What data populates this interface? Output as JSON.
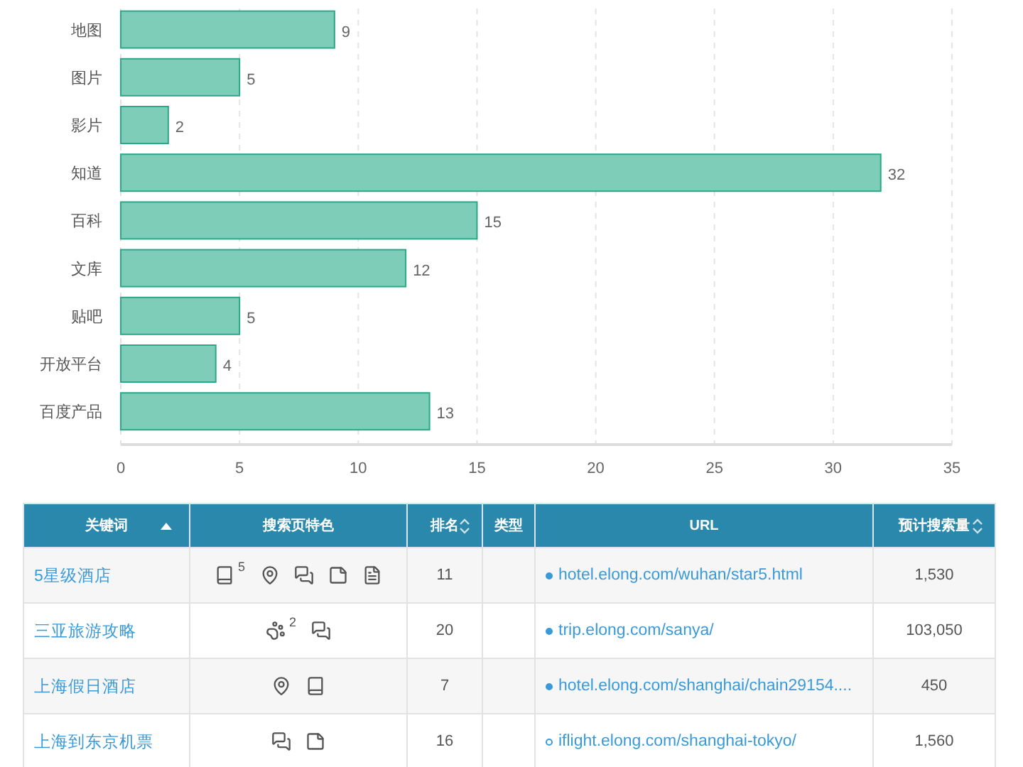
{
  "chart": {
    "chart_data": {
      "type": "bar",
      "orientation": "horizontal",
      "categories": [
        "地图",
        "图片",
        "影片",
        "知道",
        "百科",
        "文库",
        "贴吧",
        "开放平台",
        "百度产品"
      ],
      "series": [
        {
          "color": "#7dcdb8",
          "values": [
            9,
            5,
            2,
            32,
            15,
            12,
            5,
            4,
            13
          ]
        }
      ],
      "xlim": [
        0,
        35
      ],
      "grid": true,
      "xticks": [
        0,
        5,
        10,
        15,
        20,
        25,
        30,
        35
      ],
      "data_labels": true
    }
  },
  "table": {
    "columns": [
      {
        "label": "关键词",
        "sortable": true,
        "sorted_ascending": true
      },
      {
        "label": "搜索页特色",
        "sortable": false,
        "sorted_ascending": false
      },
      {
        "label": "排名",
        "sortable": true,
        "sorted_ascending": false
      },
      {
        "label": "类型",
        "sortable": false,
        "sorted_ascending": false
      },
      {
        "label": "URL",
        "sortable": false,
        "sorted_ascending": false
      },
      {
        "label": "预计搜索量",
        "sortable": true,
        "sorted_ascending": false
      }
    ],
    "rows": [
      {
        "keyword": "5星级酒店",
        "features": [
          {
            "kind": "book",
            "count": "5"
          },
          {
            "kind": "pin"
          },
          {
            "kind": "chat"
          },
          {
            "kind": "note"
          },
          {
            "kind": "pdf"
          }
        ],
        "rank": "11",
        "url": "hotel.elong.com/wuhan/star5.html",
        "url_dot_filled": true,
        "volume": "1,530"
      },
      {
        "keyword": "三亚旅游攻略",
        "features": [
          {
            "kind": "paw",
            "count": "2"
          },
          {
            "kind": "chat"
          }
        ],
        "rank": "20",
        "url": "trip.elong.com/sanya/",
        "url_dot_filled": true,
        "volume": "103,050"
      },
      {
        "keyword": "上海假日酒店",
        "features": [
          {
            "kind": "pin"
          },
          {
            "kind": "book"
          }
        ],
        "rank": "7",
        "url": "hotel.elong.com/shanghai/chain29154....",
        "url_dot_filled": true,
        "volume": "450"
      },
      {
        "keyword": "上海到东京机票",
        "features": [
          {
            "kind": "chat"
          },
          {
            "kind": "note"
          }
        ],
        "rank": "16",
        "url": "iflight.elong.com/shanghai-tokyo/",
        "url_dot_filled": false,
        "volume": "1,560"
      }
    ]
  }
}
